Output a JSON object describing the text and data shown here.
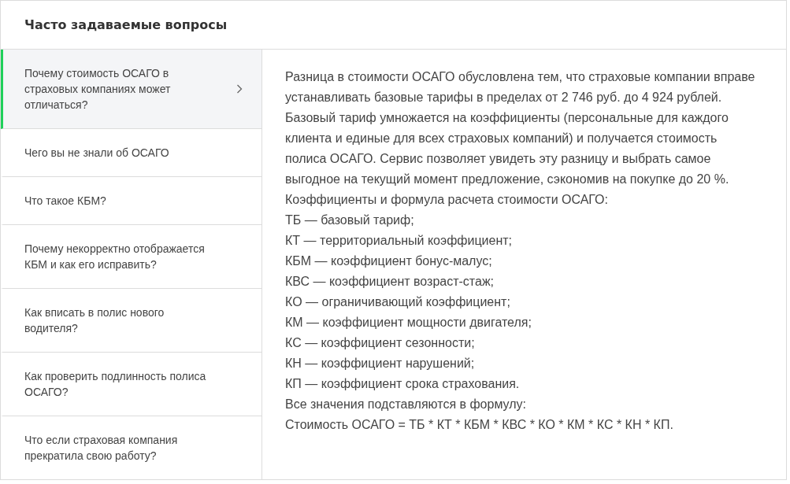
{
  "title": "Часто задаваемые вопросы",
  "questions": [
    {
      "text": "Почему стоимость ОСАГО в страховых компаниях может отличаться?",
      "selected": true
    },
    {
      "text": "Чего вы не знали об ОСАГО",
      "selected": false
    },
    {
      "text": "Что такое КБМ?",
      "selected": false
    },
    {
      "text": "Почему некорректно отображается КБМ и как его исправить?",
      "selected": false
    },
    {
      "text": "Как вписать в полис нового водителя?",
      "selected": false
    },
    {
      "text": "Как проверить подлинность полиса ОСАГО?",
      "selected": false
    },
    {
      "text": "Что если страховая компания прекратила свою работу?",
      "selected": false
    }
  ],
  "answer": {
    "intro": "Разница в стоимости ОСАГО обусловлена тем, что страховые компании вправе устанавливать базовые тарифы в пределах от 2 746 руб. до 4 924 рублей. Базовый тариф умножается на коэффициенты (персональные для каждого клиента и единые для всех страховых компаний) и получается стоимость полиса ОСАГО. Сервис позволяет увидеть эту разницу и выбрать самое выгодное на текущий момент предложение, сэкономив на покупке до 20 %. Коэффициенты и формула расчета стоимости ОСАГО:",
    "lines": [
      "ТБ — базовый тариф;",
      "КТ — территориальный коэффициент;",
      "КБМ — коэффициент бонус-малус;",
      "КВС — коэффициент возраст-стаж;",
      "КО — ограничивающий коэффициент;",
      "КМ — коэффициент мощности двигателя;",
      "КС — коэффициент сезонности;",
      "КН — коэффициент нарушений;",
      "КП — коэффициент срока страхования.",
      "Все значения подставляются в формулу:",
      "Стоимость ОСАГО = ТБ * КТ * КБМ * КВС * КО * КМ * КС * КН * КП."
    ]
  }
}
